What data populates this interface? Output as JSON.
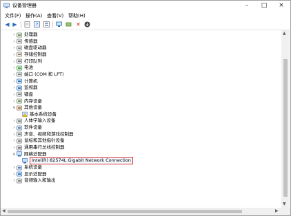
{
  "window": {
    "title": "设备管理器"
  },
  "menu": [
    "文件(F)",
    "操作(A)",
    "查看(V)",
    "帮助(H)"
  ],
  "toolbar": [
    "back-icon",
    "forward-icon",
    "properties-icon",
    "help-icon",
    "update-driver-icon",
    "monitor-icon",
    "add-icon",
    "uninstall-icon",
    "download-icon"
  ],
  "tree": [
    {
      "label": "处理器",
      "icon": "processor-icon",
      "level": 1,
      "arrow": ">"
    },
    {
      "label": "传感器",
      "icon": "sensor-icon",
      "level": 1,
      "arrow": ">"
    },
    {
      "label": "磁盘驱动器",
      "icon": "disk-icon",
      "level": 1,
      "arrow": ">"
    },
    {
      "label": "存储控制器",
      "icon": "storage-icon",
      "level": 1,
      "arrow": ">"
    },
    {
      "label": "打印队列",
      "icon": "printer-icon",
      "level": 1,
      "arrow": ">"
    },
    {
      "label": "电池",
      "icon": "battery-icon",
      "level": 1,
      "arrow": ">"
    },
    {
      "label": "端口 (COM 和 LPT)",
      "icon": "port-icon",
      "level": 1,
      "arrow": ">"
    },
    {
      "label": "计算机",
      "icon": "computer-icon",
      "level": 1,
      "arrow": ">"
    },
    {
      "label": "监视器",
      "icon": "monitor-icon",
      "level": 1,
      "arrow": ">"
    },
    {
      "label": "键盘",
      "icon": "keyboard-icon",
      "level": 1,
      "arrow": ">"
    },
    {
      "label": "内存设备",
      "icon": "memory-icon",
      "level": 1,
      "arrow": ">"
    },
    {
      "label": "其他设备",
      "icon": "other-devices-icon",
      "level": 1,
      "arrow": "v"
    },
    {
      "label": "基本系统设备",
      "icon": "warning-device-icon",
      "level": 2,
      "arrow": ""
    },
    {
      "label": "人体学输入设备",
      "icon": "hid-icon",
      "level": 1,
      "arrow": ">"
    },
    {
      "label": "软件设备",
      "icon": "software-icon",
      "level": 1,
      "arrow": ">"
    },
    {
      "label": "声音、视频和游戏控制器",
      "icon": "sound-icon",
      "level": 1,
      "arrow": ">"
    },
    {
      "label": "鼠标和其他指针设备",
      "icon": "mouse-icon",
      "level": 1,
      "arrow": ">"
    },
    {
      "label": "通用串行总线控制器",
      "icon": "usb-icon",
      "level": 1,
      "arrow": ">"
    },
    {
      "label": "网络适配器",
      "icon": "network-icon",
      "level": 1,
      "arrow": "v"
    },
    {
      "label": "Intel(R) 82574L Gigabit Network Connection",
      "icon": "network-adapter-icon",
      "level": 2,
      "arrow": "",
      "selected": true
    },
    {
      "label": "系统设备",
      "icon": "system-icon",
      "level": 1,
      "arrow": ">"
    },
    {
      "label": "显示适配器",
      "icon": "display-icon",
      "level": 1,
      "arrow": ">"
    },
    {
      "label": "音频输入和输出",
      "icon": "audio-icon",
      "level": 1,
      "arrow": ">"
    }
  ],
  "colors": {
    "selection_border": "#d93030",
    "icon_blue": "#2a6ebb"
  }
}
